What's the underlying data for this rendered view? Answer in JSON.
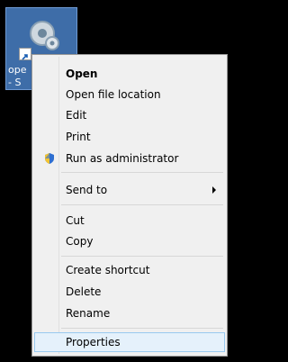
{
  "desktop": {
    "icon_name": "settings-gear-shortcut-icon",
    "label_line1": "ope",
    "label_line2": "- S"
  },
  "context_menu": {
    "items": [
      {
        "label": "Open"
      },
      {
        "label": "Open file location"
      },
      {
        "label": "Edit"
      },
      {
        "label": "Print"
      },
      {
        "label": "Run as administrator"
      },
      {
        "label": "Send to"
      },
      {
        "label": "Cut"
      },
      {
        "label": "Copy"
      },
      {
        "label": "Create shortcut"
      },
      {
        "label": "Delete"
      },
      {
        "label": "Rename"
      },
      {
        "label": "Properties"
      }
    ],
    "highlight_color": "#e5f1fb",
    "highlight_border": "#99c9ef"
  }
}
